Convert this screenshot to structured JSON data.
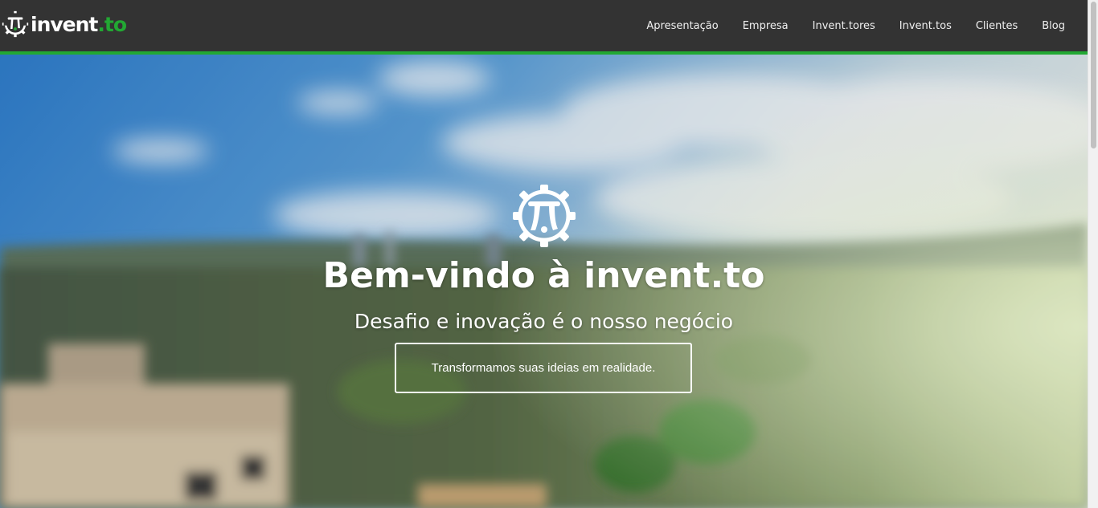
{
  "brand": {
    "name_white": "inven",
    "name_white_mark": "t",
    "name_green": ".to",
    "icon": "pi-gear-icon"
  },
  "nav": {
    "items": [
      "Apresentação",
      "Empresa",
      "Invent.tores",
      "Invent.tos",
      "Clientes",
      "Blog"
    ]
  },
  "hero": {
    "logo_icon": "pi-gear-icon",
    "title": "Bem-vindo à invent.to",
    "subtitle": "Desafio e inovação é o nosso negócio",
    "cta_label": "Transformamos suas ideias em realidade."
  },
  "colors": {
    "navbar": "#333333",
    "accent_green": "#22a833",
    "text_light": "#ffffff"
  }
}
